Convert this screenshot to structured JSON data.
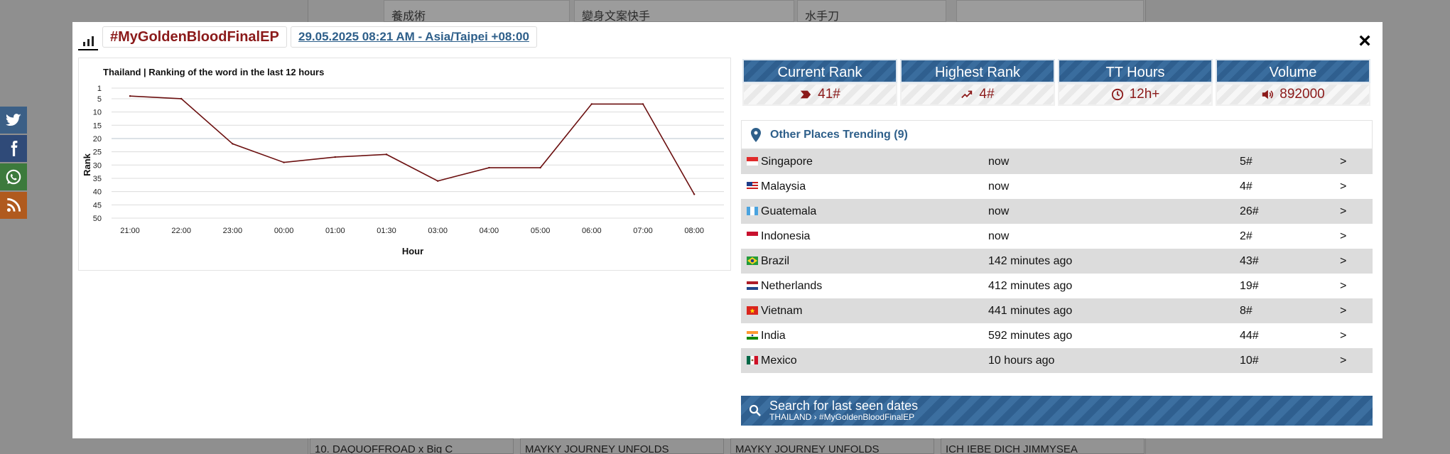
{
  "background": {
    "banners": [
      "養成術",
      "變身文案快手",
      "水手刀",
      ""
    ],
    "bottom_cells": [
      "10. DAQUOFFROAD x Big C",
      "MAYKY JOURNEY UNFOLDS",
      "MAYKY JOURNEY UNFOLDS",
      "ICH IEBE DICH JIMMYSEA"
    ]
  },
  "social": [
    {
      "icon": "twitter-icon",
      "color": "#3b5f86"
    },
    {
      "icon": "facebook-icon",
      "color": "#2f4a78"
    },
    {
      "icon": "whatsapp-icon",
      "color": "#3c7a3c"
    },
    {
      "icon": "rss-icon",
      "color": "#b05a1e"
    }
  ],
  "header": {
    "hashtag": "#MyGoldenBloodFinalEP",
    "datetime": "29.05.2025 08:21 AM - Asia/Taipei +08:00",
    "close": "×"
  },
  "chart_data": {
    "type": "line",
    "title": "Thailand | Ranking of the word in the last 12 hours",
    "xlabel": "Hour",
    "ylabel": "Rank",
    "categories": [
      "21:00",
      "22:00",
      "23:00",
      "00:00",
      "01:00",
      "01:30",
      "03:00",
      "04:00",
      "05:00",
      "06:00",
      "07:00",
      "08:00"
    ],
    "y_ticks": [
      1,
      5,
      10,
      15,
      20,
      25,
      30,
      35,
      40,
      45,
      50
    ],
    "ylim": [
      1,
      50
    ],
    "y_inverted": true,
    "series": [
      {
        "values": [
          4,
          5,
          22,
          29,
          27,
          26,
          36,
          31,
          31,
          7,
          7,
          41
        ],
        "color": "#6b0f0f"
      }
    ],
    "grid": true
  },
  "stats": [
    {
      "label": "Current Rank",
      "value": "41#",
      "icon": "chevron-badge-icon"
    },
    {
      "label": "Highest Rank",
      "value": "4#",
      "icon": "trend-up-icon"
    },
    {
      "label": "TT Hours",
      "value": "12h+",
      "icon": "clock-icon"
    },
    {
      "label": "Volume",
      "value": "892000",
      "icon": "speaker-icon"
    }
  ],
  "places": {
    "title": "Other Places Trending (9)",
    "rows": [
      {
        "country": "Singapore",
        "time": "now",
        "rank": "5#",
        "arrow": ">",
        "flag": "singapore-flag-icon"
      },
      {
        "country": "Malaysia",
        "time": "now",
        "rank": "4#",
        "arrow": ">",
        "flag": "malaysia-flag-icon"
      },
      {
        "country": "Guatemala",
        "time": "now",
        "rank": "26#",
        "arrow": ">",
        "flag": "guatemala-flag-icon"
      },
      {
        "country": "Indonesia",
        "time": "now",
        "rank": "2#",
        "arrow": ">",
        "flag": "indonesia-flag-icon"
      },
      {
        "country": "Brazil",
        "time": "142 minutes ago",
        "rank": "43#",
        "arrow": ">",
        "flag": "brazil-flag-icon"
      },
      {
        "country": "Netherlands",
        "time": "412 minutes ago",
        "rank": "19#",
        "arrow": ">",
        "flag": "netherlands-flag-icon"
      },
      {
        "country": "Vietnam",
        "time": "441 minutes ago",
        "rank": "8#",
        "arrow": ">",
        "flag": "vietnam-flag-icon"
      },
      {
        "country": "India",
        "time": "592 minutes ago",
        "rank": "44#",
        "arrow": ">",
        "flag": "india-flag-icon"
      },
      {
        "country": "Mexico",
        "time": "10 hours ago",
        "rank": "10#",
        "arrow": ">",
        "flag": "mexico-flag-icon"
      }
    ]
  },
  "search": {
    "label": "Search for last seen dates",
    "sub": "THAILAND › #MyGoldenBloodFinalEP"
  }
}
